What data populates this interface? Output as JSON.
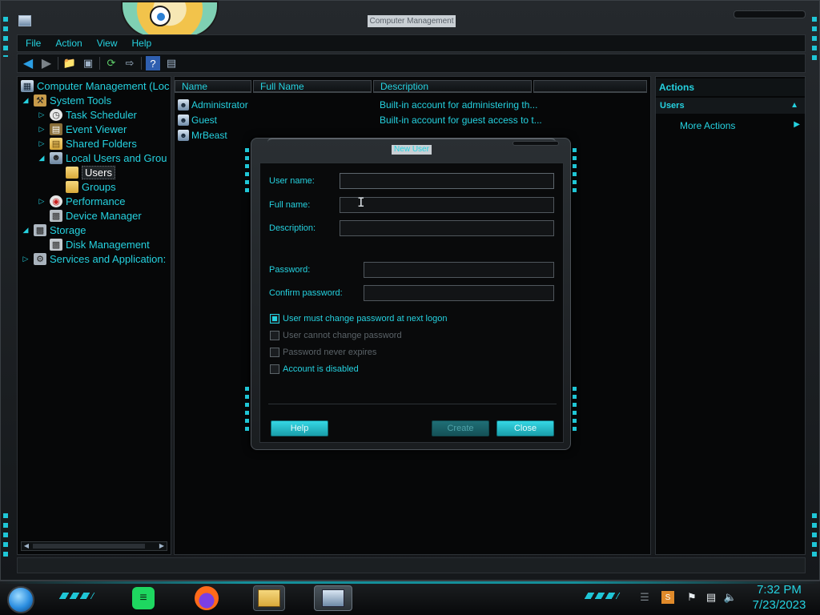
{
  "window": {
    "title": "Computer Management",
    "menu": [
      "File",
      "Action",
      "View",
      "Help"
    ]
  },
  "tree": {
    "items": [
      {
        "label": "Computer Management (Loc",
        "icon": "computer-icon"
      },
      {
        "label": "System Tools",
        "icon": "tools-icon"
      },
      {
        "label": "Task Scheduler",
        "icon": "clock-icon"
      },
      {
        "label": "Event Viewer",
        "icon": "event-viewer-icon"
      },
      {
        "label": "Shared Folders",
        "icon": "shared-folder-icon"
      },
      {
        "label": "Local Users and Grou",
        "icon": "users-icon"
      },
      {
        "label": "Users",
        "icon": "folder-icon"
      },
      {
        "label": "Groups",
        "icon": "folder-icon"
      },
      {
        "label": "Performance",
        "icon": "performance-icon"
      },
      {
        "label": "Device Manager",
        "icon": "device-manager-icon"
      },
      {
        "label": "Storage",
        "icon": "storage-icon"
      },
      {
        "label": "Disk Management",
        "icon": "disk-icon"
      },
      {
        "label": "Services and Application:",
        "icon": "services-icon"
      }
    ]
  },
  "list": {
    "columns": [
      "Name",
      "Full Name",
      "Description",
      ""
    ],
    "rows": [
      {
        "name": "Administrator",
        "full_name": "",
        "description": "Built-in account for administering th..."
      },
      {
        "name": "Guest",
        "full_name": "",
        "description": "Built-in account for guest access to t..."
      },
      {
        "name": "MrBeast",
        "full_name": "",
        "description": ""
      }
    ]
  },
  "actions": {
    "title": "Actions",
    "section": "Users",
    "more": "More Actions"
  },
  "dialog": {
    "title": "New User",
    "labels": {
      "username": "User name:",
      "fullname": "Full name:",
      "description": "Description:",
      "password": "Password:",
      "confirm": "Confirm password:"
    },
    "values": {
      "username": "",
      "fullname": "",
      "description": "",
      "password": "",
      "confirm": ""
    },
    "checkboxes": [
      {
        "label": "User must change password at next logon",
        "checked": true,
        "enabled": true
      },
      {
        "label": "User cannot change password",
        "checked": false,
        "enabled": false
      },
      {
        "label": "Password never expires",
        "checked": false,
        "enabled": false
      },
      {
        "label": "Account is disabled",
        "checked": false,
        "enabled": true
      }
    ],
    "buttons": {
      "help": "Help",
      "create": "Create",
      "close": "Close"
    }
  },
  "taskbar": {
    "time": "7:32 PM",
    "date": "7/23/2023",
    "apps": [
      "spotify-icon",
      "firefox-icon",
      "file-explorer-icon",
      "computer-management-icon"
    ],
    "tray": [
      "sublime-text-icon",
      "flag-icon",
      "network-icon",
      "volume-icon"
    ]
  },
  "colors": {
    "accent": "#25d2e0",
    "background": "#060708",
    "button": "#25c3d1"
  }
}
